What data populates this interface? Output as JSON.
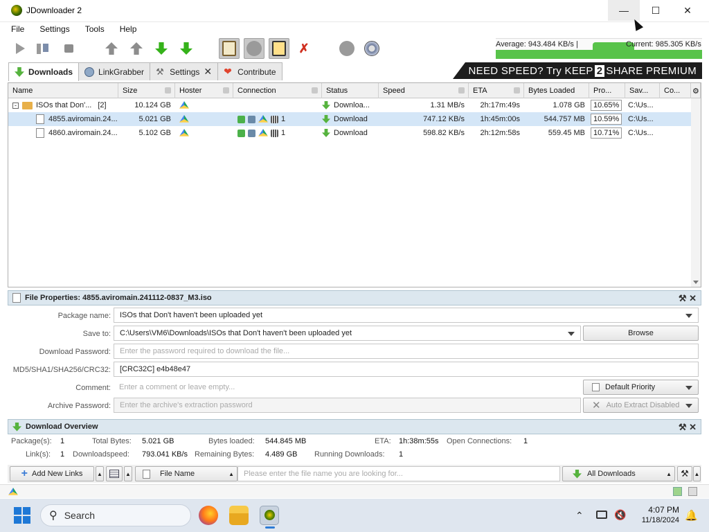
{
  "window": {
    "title": "JDownloader 2"
  },
  "menu": [
    "File",
    "Settings",
    "Tools",
    "Help"
  ],
  "speed": {
    "average": "Average: 943.484 KB/s |",
    "current": "Current: 985.305 KB/s"
  },
  "tabs": [
    {
      "label": "Downloads"
    },
    {
      "label": "LinkGrabber"
    },
    {
      "label": "Settings"
    },
    {
      "label": "Contribute"
    }
  ],
  "banner": {
    "pre": "NEED SPEED? Try KEEP",
    "num": "2",
    "post": "SHARE PREMIUM"
  },
  "table": {
    "columns": [
      "Name",
      "Size",
      "Hoster",
      "Connection",
      "Status",
      "Speed",
      "ETA",
      "Bytes Loaded",
      "Pro...",
      "Sav...",
      "Co..."
    ],
    "package": {
      "name": "ISOs that Don'...",
      "count": "[2]",
      "size": "10.124 GB",
      "status": "Downloa...",
      "speed": "1.31 MB/s",
      "eta": "2h:17m:49s",
      "bytes": "1.078 GB",
      "progress": "10.65%",
      "save": "C:\\Us..."
    },
    "files": [
      {
        "name": "4855.aviromain.24...",
        "size": "5.021 GB",
        "conn_count": "1",
        "status": "Download",
        "speed": "747.12 KB/s",
        "eta": "1h:45m:00s",
        "bytes": "544.757 MB",
        "progress": "10.59%",
        "save": "C:\\Us..."
      },
      {
        "name": "4860.aviromain.24...",
        "size": "5.102 GB",
        "conn_count": "1",
        "status": "Download",
        "speed": "598.82 KB/s",
        "eta": "2h:12m:58s",
        "bytes": "559.45 MB",
        "progress": "10.71%",
        "save": "C:\\Us..."
      }
    ]
  },
  "props": {
    "title": "File Properties: 4855.aviromain.241112-0837_M3.iso",
    "package_label": "Package name:",
    "package_value": "ISOs that Don't haven't been uploaded yet",
    "save_label": "Save to:",
    "save_value": "C:\\Users\\VM6\\Downloads\\ISOs that Don't haven't been uploaded yet",
    "browse": "Browse",
    "password_label": "Download Password:",
    "password_placeholder": "Enter the password required to download the file...",
    "hash_label": "MD5/SHA1/SHA256/CRC32:",
    "hash_value": "[CRC32C] e4b48e47",
    "comment_label": "Comment:",
    "comment_placeholder": "Enter a comment or leave empty...",
    "priority": "Default Priority",
    "archive_label": "Archive Password:",
    "archive_placeholder": "Enter the archive's extraction password",
    "extract": "Auto Extract Disabled"
  },
  "overview": {
    "title": "Download Overview",
    "packages_label": "Package(s):",
    "packages": "1",
    "total_label": "Total Bytes:",
    "total": "5.021 GB",
    "loaded_label": "Bytes loaded:",
    "loaded": "544.845 MB",
    "eta_label": "ETA:",
    "eta": "1h:38m:55s",
    "open_label": "Open Connections:",
    "open": "1",
    "links_label": "Link(s):",
    "links": "1",
    "speed_label": "Downloadspeed:",
    "speed": "793.041 KB/s",
    "remaining_label": "Remaining Bytes:",
    "remaining": "4.489 GB",
    "running_label": "Running Downloads:",
    "running": "1"
  },
  "bottom": {
    "add_links": "Add New Links",
    "filter_field": "File Name",
    "search_placeholder": "Please enter the file name you are looking for...",
    "view": "All Downloads"
  },
  "taskbar": {
    "search": "Search",
    "time": "4:07 PM",
    "date": "11/18/2024"
  }
}
